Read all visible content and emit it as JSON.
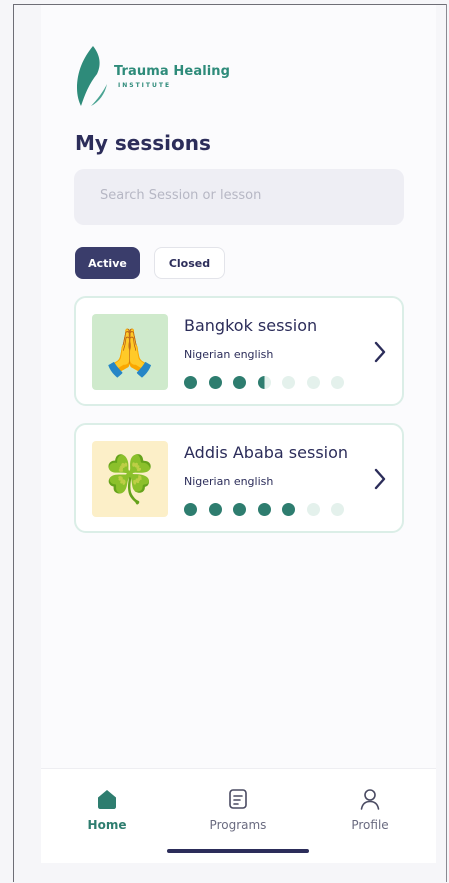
{
  "brand": {
    "name": "Trauma Healing",
    "subtitle": "INSTITUTE",
    "logo_icon": "leaf-logo-icon",
    "color": "#2e8b7a"
  },
  "page": {
    "title": "My sessions"
  },
  "search": {
    "placeholder": "Search Session or lesson",
    "value": ""
  },
  "tabs": [
    {
      "label": "Active",
      "selected": true
    },
    {
      "label": "Closed",
      "selected": false
    }
  ],
  "sessions": [
    {
      "title": "Bangkok session",
      "language": "Nigerian english",
      "emoji": "🙏",
      "thumb_color": "#cfeacc",
      "progress": {
        "total": 7,
        "completed": 3.5
      }
    },
    {
      "title": "Addis Ababa session",
      "language": "Nigerian english",
      "emoji": "🍀",
      "thumb_color": "#fcefc8",
      "progress": {
        "total": 7,
        "completed": 5
      }
    }
  ],
  "nav": {
    "home": {
      "label": "Home",
      "icon": "home-icon",
      "active": true
    },
    "programs": {
      "label": "Programs",
      "icon": "document-icon",
      "active": false
    },
    "profile": {
      "label": "Profile",
      "icon": "user-icon",
      "active": false
    }
  },
  "colors": {
    "primary": "#2c2d5a",
    "accent": "#2e7d6f",
    "tab_active_bg": "#3a3d6b"
  }
}
